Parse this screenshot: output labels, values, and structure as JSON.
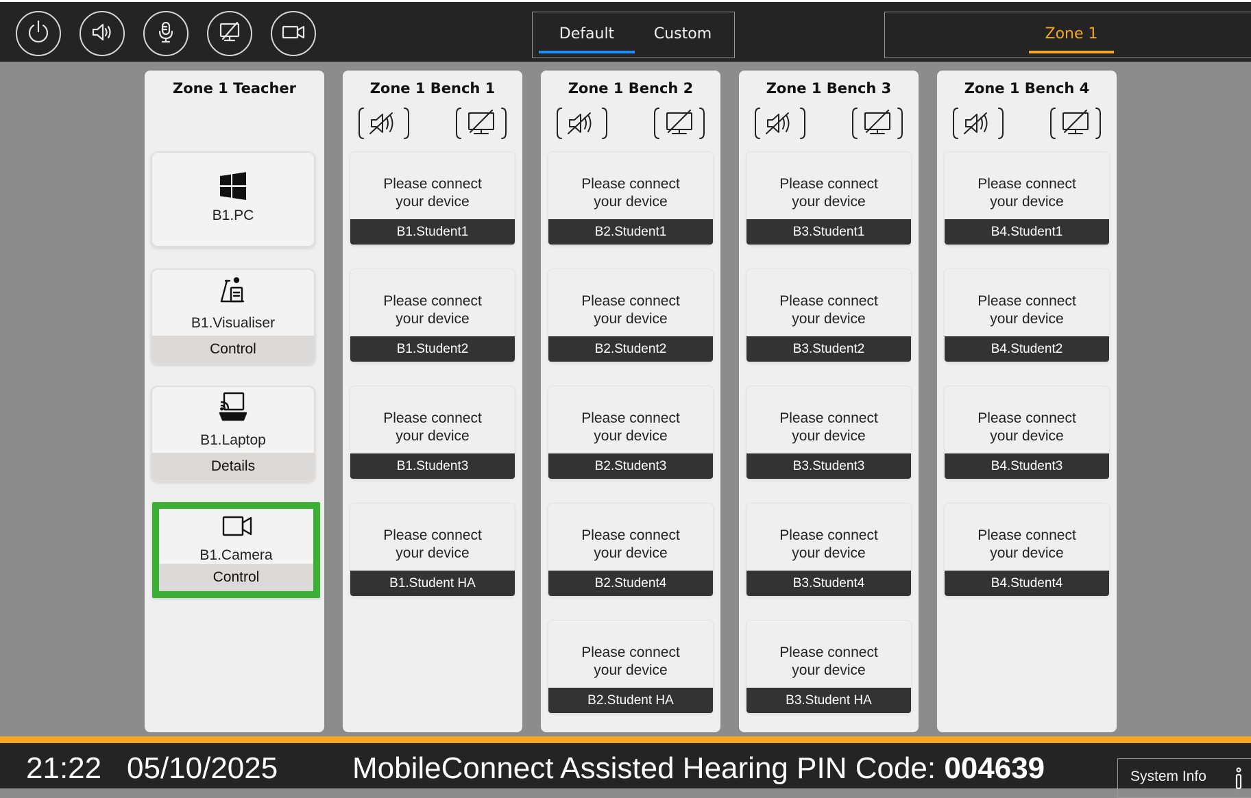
{
  "header": {
    "buttons": [
      {
        "icon": "power-icon"
      },
      {
        "icon": "speaker-icon"
      },
      {
        "icon": "microphone-icon"
      },
      {
        "icon": "display-off-icon"
      },
      {
        "icon": "camera-icon"
      }
    ],
    "mode_tabs": [
      {
        "label": "Default",
        "active": true
      },
      {
        "label": "Custom",
        "active": false
      }
    ],
    "zone_tab": "Zone 1"
  },
  "colors": {
    "accent_blue": "#1e90ff",
    "accent_orange": "#f5a623",
    "highlight_green": "#3cb034"
  },
  "teacher": {
    "title": "Zone 1 Teacher",
    "sources": [
      {
        "name": "B1.PC",
        "icon": "windows-icon",
        "action": ""
      },
      {
        "name": "B1.Visualiser",
        "icon": "visualiser-icon",
        "action": "Control"
      },
      {
        "name": "B1.Laptop",
        "icon": "cast-laptop-icon",
        "action": "Details"
      },
      {
        "name": "B1.Camera",
        "icon": "camera-icon",
        "action": "Control",
        "selected": true
      }
    ]
  },
  "connect_message": "Please connect your device",
  "benches": [
    {
      "title": "Zone 1 Bench 1",
      "students": [
        "B1.Student1",
        "B1.Student2",
        "B1.Student3",
        "B1.Student HA"
      ]
    },
    {
      "title": "Zone 1 Bench 2",
      "students": [
        "B2.Student1",
        "B2.Student2",
        "B2.Student3",
        "B2.Student4",
        "B2.Student HA"
      ]
    },
    {
      "title": "Zone 1 Bench 3",
      "students": [
        "B3.Student1",
        "B3.Student2",
        "B3.Student3",
        "B3.Student4",
        "B3.Student HA"
      ]
    },
    {
      "title": "Zone 1 Bench 4",
      "students": [
        "B4.Student1",
        "B4.Student2",
        "B4.Student3",
        "B4.Student4"
      ]
    }
  ],
  "footer": {
    "time": "21:22",
    "date": "05/10/2025",
    "pin_label": "MobileConnect Assisted Hearing PIN Code: ",
    "pin_code": "004639",
    "system_info": "System Info"
  }
}
